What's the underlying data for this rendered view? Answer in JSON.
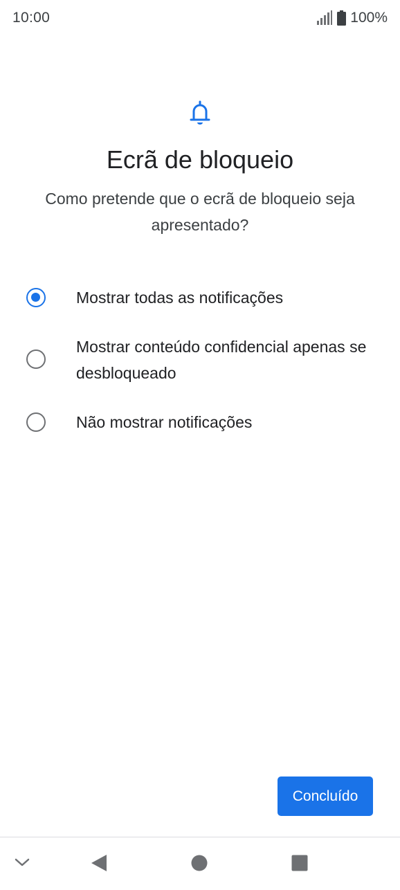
{
  "status_bar": {
    "time": "10:00",
    "battery_percent": "100%",
    "icons": [
      "signal-icon",
      "battery-icon"
    ]
  },
  "header": {
    "icon": "bell-icon",
    "title": "Ecrã de bloqueio",
    "subtitle": "Como pretende que o ecrã de bloqueio seja apresentado?"
  },
  "options": [
    {
      "label": "Mostrar todas as notificações",
      "selected": true
    },
    {
      "label": "Mostrar conteúdo confidencial apenas se desbloqueado",
      "selected": false
    },
    {
      "label": "Não mostrar notificações",
      "selected": false
    }
  ],
  "done_label": "Concluído",
  "nav_bar": {
    "icons": [
      "chevron-down-icon",
      "back-icon",
      "home-icon",
      "recents-icon"
    ]
  },
  "colors": {
    "accent": "#1a73e8",
    "text": "#202124",
    "radio_unchecked": "#6e7073"
  }
}
